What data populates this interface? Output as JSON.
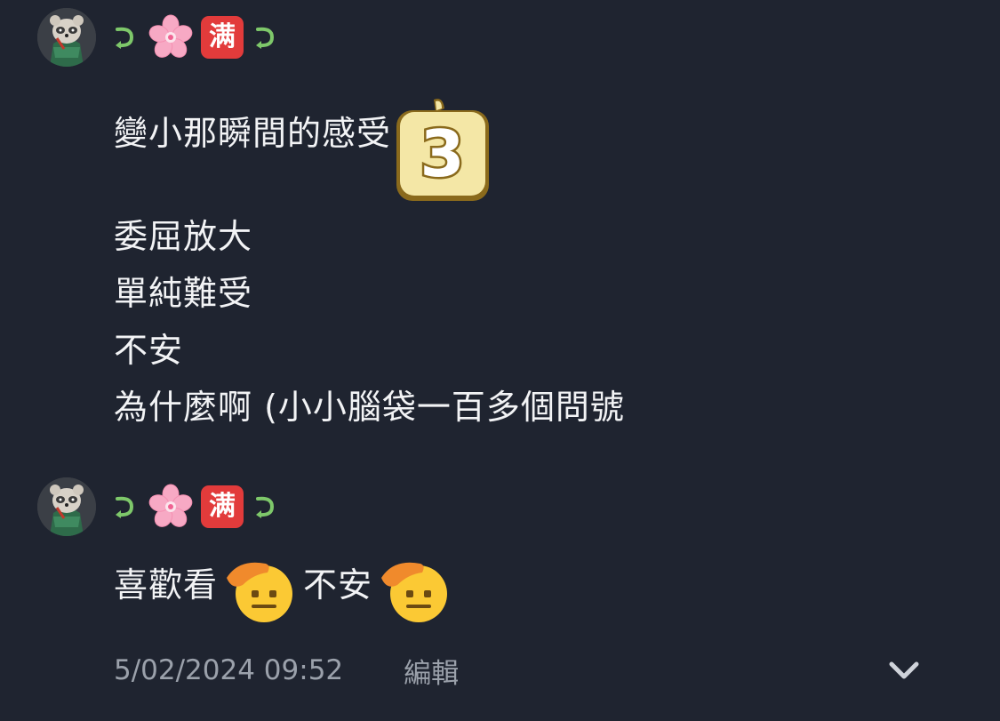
{
  "posts": [
    {
      "author": {
        "avatar_icon": "raccoon-avatar-icon",
        "name_icons": [
          "hook-arrow-icon",
          "cherry-blossom-icon",
          "man-kanji-badge-icon",
          "hook-arrow-icon"
        ],
        "name_badge_text": "满"
      },
      "lines": [
        "變小那瞬間的感受",
        "",
        "委屈放大",
        "單純難受",
        "不安",
        "為什麼啊 (小小腦袋一百多個問號"
      ],
      "sticker": {
        "icon": "number-three-sticker-icon",
        "text": "3"
      }
    },
    {
      "author": {
        "avatar_icon": "raccoon-avatar-icon",
        "name_icons": [
          "hook-arrow-icon",
          "cherry-blossom-icon",
          "man-kanji-badge-icon",
          "hook-arrow-icon"
        ],
        "name_badge_text": "满"
      },
      "line_parts": [
        "喜歡看",
        "不安"
      ],
      "emoji": "saluting-face-icon"
    }
  ],
  "footer": {
    "timestamp": "5/02/2024 09:52",
    "edit_label": "編輯",
    "expand_icon": "chevron-down-icon"
  },
  "colors": {
    "background": "#1f2430",
    "text": "#f2f3f5",
    "muted": "#9ba1ab",
    "hook": "#7ec86a",
    "badge": "#e23b3b"
  }
}
